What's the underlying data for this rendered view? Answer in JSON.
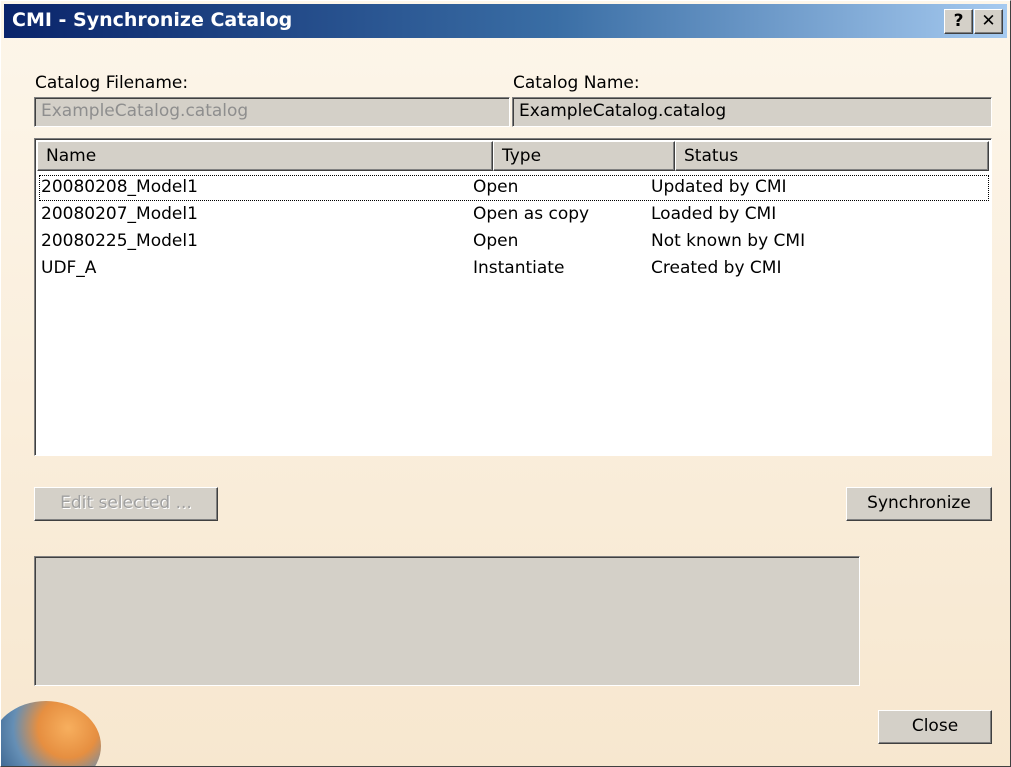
{
  "window": {
    "title": "CMI - Synchronize Catalog",
    "help_label": "?",
    "close_label": "✕"
  },
  "catalog_filename": {
    "label": "Catalog Filename:",
    "value": "ExampleCatalog.catalog"
  },
  "catalog_name": {
    "label": "Catalog Name:",
    "value": "ExampleCatalog.catalog"
  },
  "table": {
    "columns": [
      "Name",
      "Type",
      "Status"
    ],
    "rows": [
      {
        "name": "20080208_Model1",
        "type": "Open",
        "status": "Updated by CMI"
      },
      {
        "name": "20080207_Model1",
        "type": "Open as copy",
        "status": "Loaded by CMI"
      },
      {
        "name": "20080225_Model1",
        "type": "Open",
        "status": "Not known by CMI"
      },
      {
        "name": "UDF_A",
        "type": "Instantiate",
        "status": "Created by CMI"
      }
    ]
  },
  "buttons": {
    "edit_selected": "Edit selected ...",
    "synchronize": "Synchronize",
    "close": "Close"
  },
  "icons": {
    "logo": "catia-globe-logo"
  }
}
